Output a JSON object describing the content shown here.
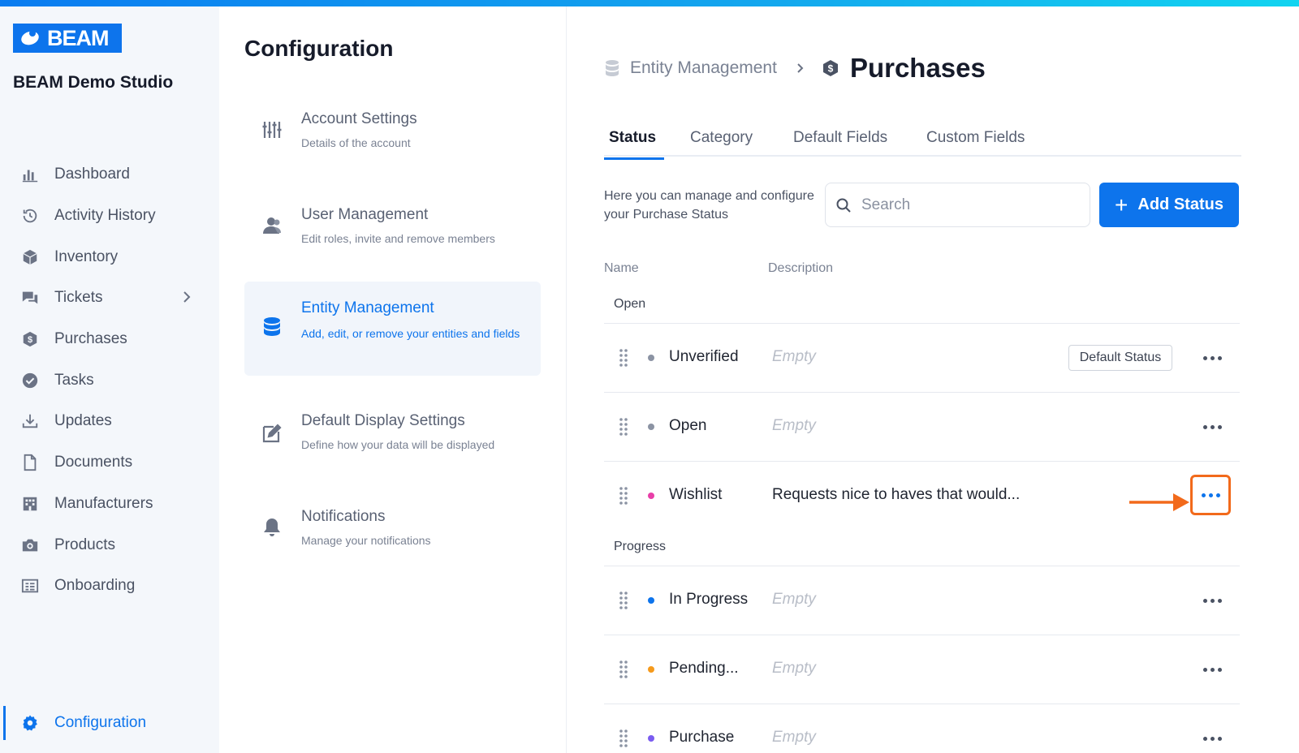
{
  "colors": {
    "accent": "#0d74ec",
    "highlight": "#f26a1b"
  },
  "brand": {
    "logo": "BEAM",
    "studio": "BEAM Demo Studio"
  },
  "sidebar": {
    "items": [
      {
        "label": "Dashboard",
        "icon": "bar-chart-icon"
      },
      {
        "label": "Activity History",
        "icon": "history-icon"
      },
      {
        "label": "Inventory",
        "icon": "cube-icon"
      },
      {
        "label": "Tickets",
        "icon": "chat-icon"
      },
      {
        "label": "Purchases",
        "icon": "dollar-shield-icon"
      },
      {
        "label": "Tasks",
        "icon": "check-circle-icon"
      },
      {
        "label": "Updates",
        "icon": "download-icon"
      },
      {
        "label": "Documents",
        "icon": "document-icon"
      },
      {
        "label": "Manufacturers",
        "icon": "building-icon"
      },
      {
        "label": "Products",
        "icon": "camera-icon"
      },
      {
        "label": "Onboarding",
        "icon": "list-icon"
      }
    ],
    "config_label": "Configuration"
  },
  "config": {
    "title": "Configuration",
    "items": [
      {
        "title": "Account Settings",
        "desc": "Details of the account",
        "icon": "sliders-icon"
      },
      {
        "title": "User Management",
        "desc": "Edit roles, invite and remove members",
        "icon": "users-icon"
      },
      {
        "title": "Entity Management",
        "desc": "Add, edit, or remove your entities and fields",
        "icon": "database-icon"
      },
      {
        "title": "Default Display Settings",
        "desc": "Define how your data will be displayed",
        "icon": "edit-icon"
      },
      {
        "title": "Notifications",
        "desc": "Manage your notifications",
        "icon": "bell-icon"
      }
    ]
  },
  "main": {
    "breadcrumb": {
      "parent": "Entity Management",
      "current": "Purchases"
    },
    "tabs": [
      "Status",
      "Category",
      "Default Fields",
      "Custom Fields"
    ],
    "intro": "Here you can manage and configure your Purchase Status",
    "search_placeholder": "Search",
    "add_button": "Add Status",
    "columns": {
      "name": "Name",
      "description": "Description"
    },
    "groups": {
      "open": "Open",
      "progress": "Progress"
    },
    "empty_text": "Empty",
    "default_badge": "Default Status",
    "rows": [
      {
        "name": "Unverified",
        "desc": "Empty",
        "color": "#8b93a3"
      },
      {
        "name": "Open",
        "desc": "Empty",
        "color": "#8b93a3"
      },
      {
        "name": "Wishlist",
        "desc": "Requests nice to haves that would...",
        "color": "#e83fa8"
      },
      {
        "name": "In Progress",
        "desc": "Empty",
        "color": "#0d74ec"
      },
      {
        "name": "Pending...",
        "desc": "Empty",
        "color": "#f59a1c"
      },
      {
        "name": "Purchase",
        "desc": "Empty",
        "color": "#7a5cf0"
      }
    ]
  }
}
